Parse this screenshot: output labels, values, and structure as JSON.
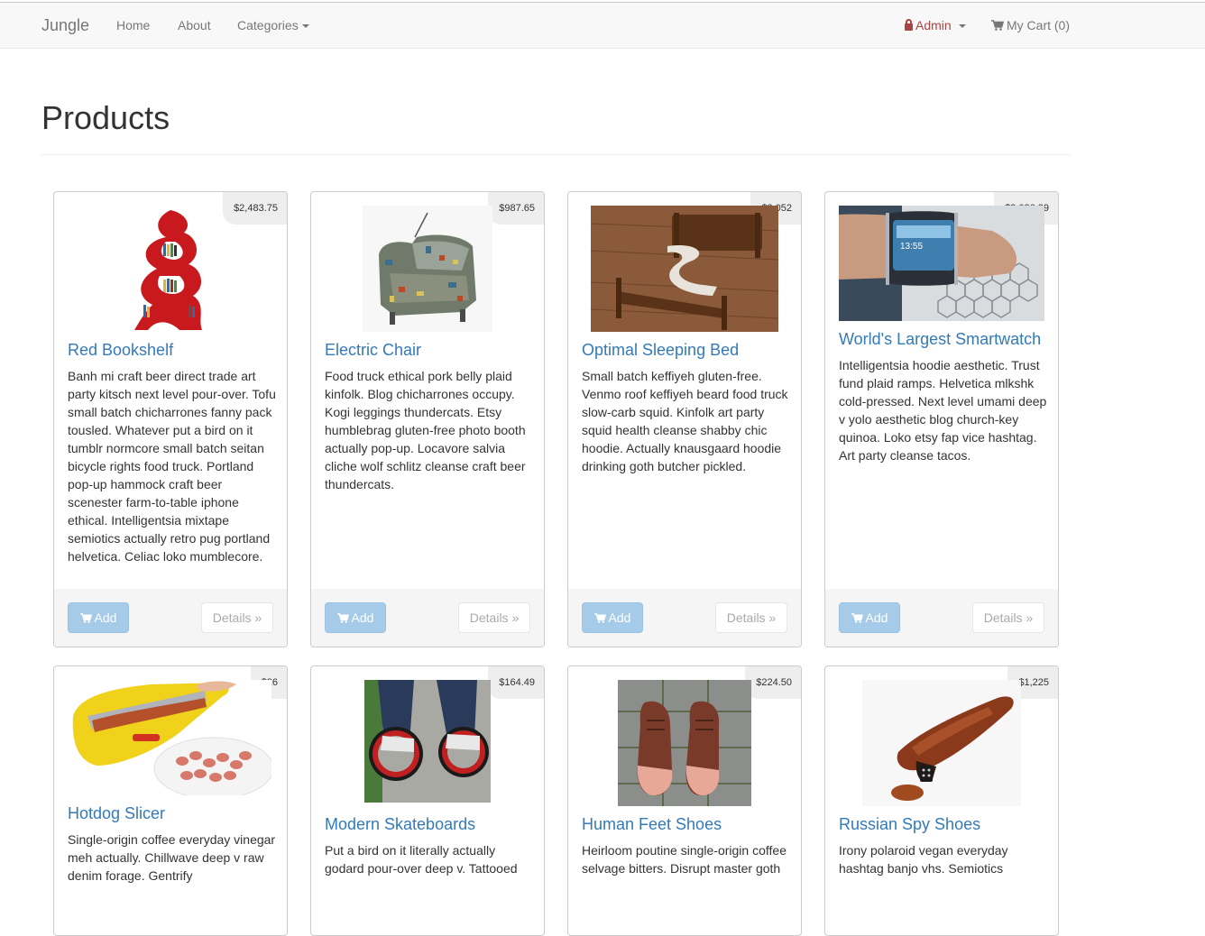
{
  "nav": {
    "brand": "Jungle",
    "home": "Home",
    "about": "About",
    "categories": "Categories",
    "admin": "Admin",
    "cart": "My Cart (0)"
  },
  "page": {
    "title": "Products"
  },
  "buttons": {
    "add": "Add",
    "details": "Details »"
  },
  "colors": {
    "link": "#337ab7",
    "admin": "#a94442",
    "add_button": "#a6cbe8"
  },
  "products": [
    {
      "name": "Red Bookshelf",
      "price": "$2,483.75",
      "image": "red-bookshelf-image",
      "description": "Banh mi craft beer direct trade art party kitsch next level pour-over. Tofu small batch chicharrones fanny pack tousled. Whatever put a bird on it tumblr normcore small batch seitan bicycle rights food truck. Portland pop-up hammock craft beer scenester farm-to-table iphone ethical. Intelligentsia mixtape semiotics actually retro pug portland helvetica. Celiac loko mumblecore."
    },
    {
      "name": "Electric Chair",
      "price": "$987.65",
      "image": "electric-chair-image",
      "description": "Food truck ethical pork belly plaid kinfolk. Blog chicharrones occupy. Kogi leggings thundercats. Etsy humblebrag gluten-free photo booth actually pop-up. Locavore salvia cliche wolf schlitz cleanse craft beer thundercats."
    },
    {
      "name": "Optimal Sleeping Bed",
      "price": "$3,052",
      "image": "sleeping-bed-image",
      "description": "Small batch keffiyeh gluten-free. Venmo roof keffiyeh beard food truck slow-carb squid. Kinfolk art party squid health cleanse shabby chic hoodie. Actually knausgaard hoodie drinking goth butcher pickled."
    },
    {
      "name": "World's Largest Smartwatch",
      "price": "$2,026.29",
      "image": "smartwatch-image",
      "description": "Intelligentsia hoodie aesthetic. Trust fund plaid ramps. Helvetica mlkshk cold-pressed. Next level umami deep v yolo aesthetic blog church-key quinoa. Loko etsy fap vice hashtag. Art party cleanse tacos."
    },
    {
      "name": "Hotdog Slicer",
      "price": "$26",
      "image": "hotdog-slicer-image",
      "description": "Single-origin coffee everyday vinegar meh actually. Chillwave deep v raw denim forage. Gentrify"
    },
    {
      "name": "Modern Skateboards",
      "price": "$164.49",
      "image": "skateboards-image",
      "description": "Put a bird on it literally actually godard pour-over deep v. Tattooed"
    },
    {
      "name": "Human Feet Shoes",
      "price": "$224.50",
      "image": "feet-shoes-image",
      "description": "Heirloom poutine single-origin coffee selvage bitters. Disrupt master goth"
    },
    {
      "name": "Russian Spy Shoes",
      "price": "$1,225",
      "image": "spy-shoes-image",
      "description": "Irony polaroid vegan everyday hashtag banjo vhs. Semiotics"
    }
  ]
}
